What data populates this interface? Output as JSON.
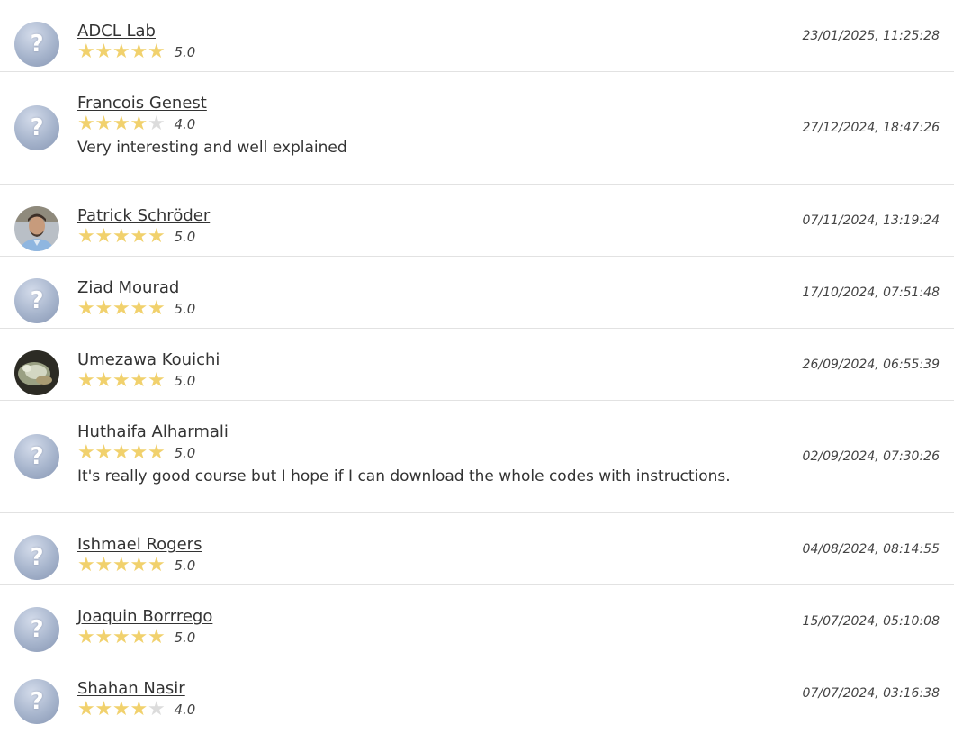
{
  "reviews": [
    {
      "name": "ADCL Lab",
      "stars": 5,
      "score": "5.0",
      "comment": "",
      "date": "23/01/2025, 11:25:28",
      "avatar": "default-avatar"
    },
    {
      "name": "Francois Genest",
      "stars": 4,
      "score": "4.0",
      "comment": "Very interesting and well explained",
      "date": "27/12/2024, 18:47:26",
      "avatar": "default-avatar"
    },
    {
      "name": "Patrick Schröder",
      "stars": 5,
      "score": "5.0",
      "comment": "",
      "date": "07/11/2024, 13:19:24",
      "avatar": "person-photo"
    },
    {
      "name": "Ziad Mourad",
      "stars": 5,
      "score": "5.0",
      "comment": "",
      "date": "17/10/2024, 07:51:48",
      "avatar": "default-avatar"
    },
    {
      "name": "Umezawa Kouichi",
      "stars": 5,
      "score": "5.0",
      "comment": "",
      "date": "26/09/2024, 06:55:39",
      "avatar": "animal-photo"
    },
    {
      "name": "Huthaifa Alharmali",
      "stars": 5,
      "score": "5.0",
      "comment": "It's really good course but I hope if I can download the whole codes with instructions.",
      "date": "02/09/2024, 07:30:26",
      "avatar": "default-avatar"
    },
    {
      "name": "Ishmael Rogers",
      "stars": 5,
      "score": "5.0",
      "comment": "",
      "date": "04/08/2024, 08:14:55",
      "avatar": "default-avatar"
    },
    {
      "name": "Joaquin Borrrego",
      "stars": 5,
      "score": "5.0",
      "comment": "",
      "date": "15/07/2024, 05:10:08",
      "avatar": "default-avatar"
    },
    {
      "name": "Shahan Nasir",
      "stars": 4,
      "score": "4.0",
      "comment": "",
      "date": "07/07/2024, 03:16:38",
      "avatar": "default-avatar"
    }
  ],
  "rating_max": 5,
  "default_avatar_glyph": "?",
  "colors": {
    "star_filled": "#f1d16d",
    "star_empty": "#dcdcdc",
    "divider": "#e2e2e2"
  }
}
